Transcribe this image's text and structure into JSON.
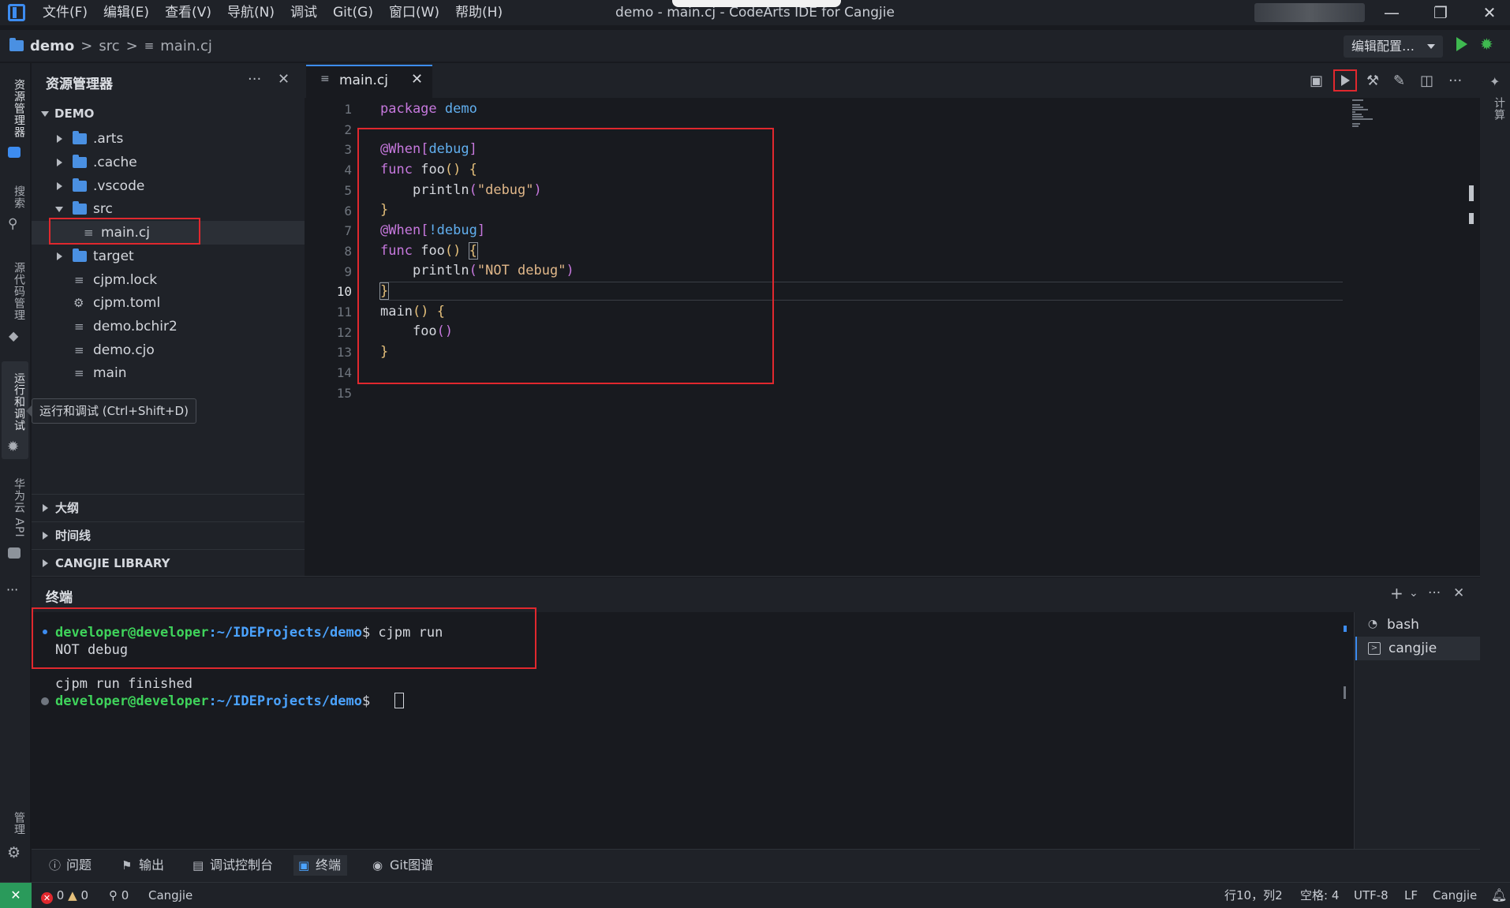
{
  "window": {
    "title": "demo - main.cj - CodeArts IDE for Cangjie",
    "menu": [
      "文件(F)",
      "编辑(E)",
      "查看(V)",
      "导航(N)",
      "调试",
      "Git(G)",
      "窗口(W)",
      "帮助(H)"
    ],
    "controls": {
      "minimize": "—",
      "restore": "❐",
      "close": "✕"
    }
  },
  "breadcrumb": {
    "project": "demo",
    "sep1": ">",
    "folder": "src",
    "sep2": ">",
    "file_icon": "≡",
    "file": "main.cj"
  },
  "toolbar": {
    "config_label": "编辑配置…",
    "run_icon": "play-icon",
    "debug_icon": "bug-icon"
  },
  "activity_bar": {
    "explorer": "资源管理器",
    "search": "搜索",
    "scm": "源代码管理",
    "run_debug": "运行和调试",
    "huawei_api": "华为云 API",
    "more": "···",
    "manage": "管理"
  },
  "right_strip": {
    "label": "计算"
  },
  "sidebar": {
    "title": "资源管理器",
    "more": "···",
    "close": "✕",
    "root": "DEMO",
    "tree": [
      {
        "label": ".arts",
        "type": "folder",
        "expanded": false
      },
      {
        "label": ".cache",
        "type": "folder",
        "expanded": false
      },
      {
        "label": ".vscode",
        "type": "folder",
        "expanded": false
      },
      {
        "label": "src",
        "type": "folder",
        "expanded": true
      },
      {
        "label": "main.cj",
        "type": "file",
        "selected": true
      },
      {
        "label": "target",
        "type": "folder",
        "expanded": false
      },
      {
        "label": "cjpm.lock",
        "type": "file"
      },
      {
        "label": "cjpm.toml",
        "type": "settings-file"
      },
      {
        "label": "demo.bchir2",
        "type": "file"
      },
      {
        "label": "demo.cjo",
        "type": "file"
      },
      {
        "label": "main",
        "type": "file"
      }
    ],
    "tooltip": "运行和调试 (Ctrl+Shift+D)",
    "sections": [
      "大纲",
      "时间线",
      "CANGJIE LIBRARY"
    ]
  },
  "editor": {
    "tab_icon": "≡",
    "tab_label": "main.cj",
    "tab_close": "✕",
    "active_line": 10,
    "line_numbers": [
      "1",
      "2",
      "3",
      "4",
      "5",
      "6",
      "7",
      "8",
      "9",
      "10",
      "11",
      "12",
      "13",
      "14",
      "15"
    ]
  },
  "panel": {
    "title": "终端",
    "add": "+",
    "dropdown": "⌄",
    "more": "···",
    "close": "✕",
    "terminal_lines": [
      {
        "user": "developer@developer",
        "path": ":~/IDEProjects/demo",
        "prompt": "$ ",
        "cmd": "cjpm run"
      },
      {
        "text": "NOT debug"
      },
      {
        "text": "cjpm run finished"
      },
      {
        "user": "developer@developer",
        "path": ":~/IDEProjects/demo",
        "prompt": "$ ",
        "cmd": ""
      }
    ],
    "terminals": [
      {
        "label": "bash",
        "active": false
      },
      {
        "label": "cangjie",
        "active": true
      }
    ]
  },
  "panel_tabs": [
    {
      "label": "问题",
      "icon": "info-icon"
    },
    {
      "label": "输出",
      "icon": "flag-icon"
    },
    {
      "label": "调试控制台",
      "icon": "console-icon"
    },
    {
      "label": "终端",
      "icon": "terminal-icon",
      "active": true
    },
    {
      "label": "Git图谱",
      "icon": "git-icon"
    }
  ],
  "statusbar": {
    "remote": "✕",
    "errors": "0",
    "warnings": "0",
    "ports": "0",
    "language_left": "Cangjie",
    "position": "行10，列2",
    "spaces": "空格: 4",
    "encoding": "UTF-8",
    "eol": "LF",
    "language": "Cangjie",
    "notify": "bell-icon"
  },
  "colors": {
    "accent": "#3d8cf0",
    "highlight_box": "#e0282e",
    "run_green": "#3fb950",
    "terminal_user": "#3fd35b",
    "terminal_path": "#4ba3ff"
  }
}
